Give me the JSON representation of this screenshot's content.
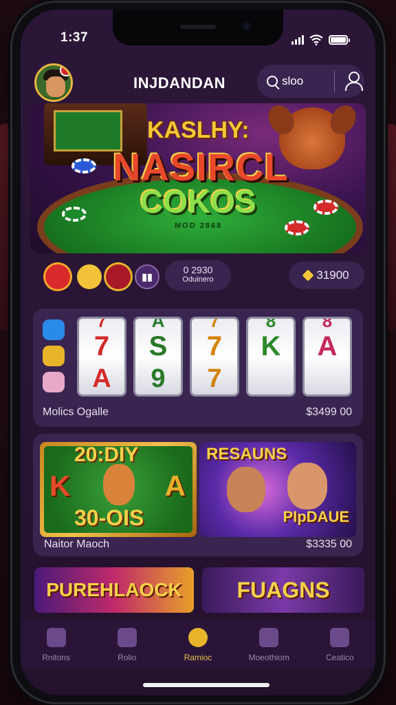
{
  "status": {
    "time": "1:37"
  },
  "header": {
    "title": "INJDANDAN",
    "search_text": "sloo"
  },
  "banner": {
    "line1": "KASLHY:",
    "line2": "NASIRCL",
    "line3": "COKOS",
    "line4": "MOD 2868"
  },
  "wallet": {
    "balance_value": "0 2930",
    "balance_label": "Oduinero",
    "coins": "31900"
  },
  "slot_card": {
    "reels": [
      {
        "top": "7",
        "mid": "7",
        "bot": "A",
        "color": "#d42a2a"
      },
      {
        "top": "A",
        "mid": "S",
        "bot": "9",
        "color": "#2a7a2a"
      },
      {
        "top": "7",
        "mid": "7",
        "bot": "7",
        "color": "#d4820a"
      },
      {
        "top": "8",
        "mid": "K",
        "bot": "",
        "color": "#2a8a2a"
      },
      {
        "top": "8",
        "mid": "A",
        "bot": "",
        "color": "#c42a5a"
      }
    ],
    "name": "Molics Ogalle",
    "price": "$3499 00"
  },
  "game_card": {
    "tile1": {
      "line1": "20:DIY",
      "left": "K",
      "right": "A",
      "line4": "30-OIS"
    },
    "tile2": {
      "line1": "RESAUNS",
      "line2": "PIpDAUE"
    },
    "name": "Naitor Maoch",
    "price": "$3335 00"
  },
  "promos": {
    "left": "PUREHLAOCK",
    "right": "FUAGNS"
  },
  "tabs": [
    {
      "label": "Rnitons",
      "icon": "home-icon"
    },
    {
      "label": "Rolio",
      "icon": "cards-icon"
    },
    {
      "label": "Ramioc",
      "icon": "chip-icon"
    },
    {
      "label": "Moeothiom",
      "icon": "camera-icon"
    },
    {
      "label": "Ceatico",
      "icon": "profile-icon"
    }
  ],
  "colors": {
    "accent": "#e8b42a",
    "surface": "#3a2450"
  }
}
